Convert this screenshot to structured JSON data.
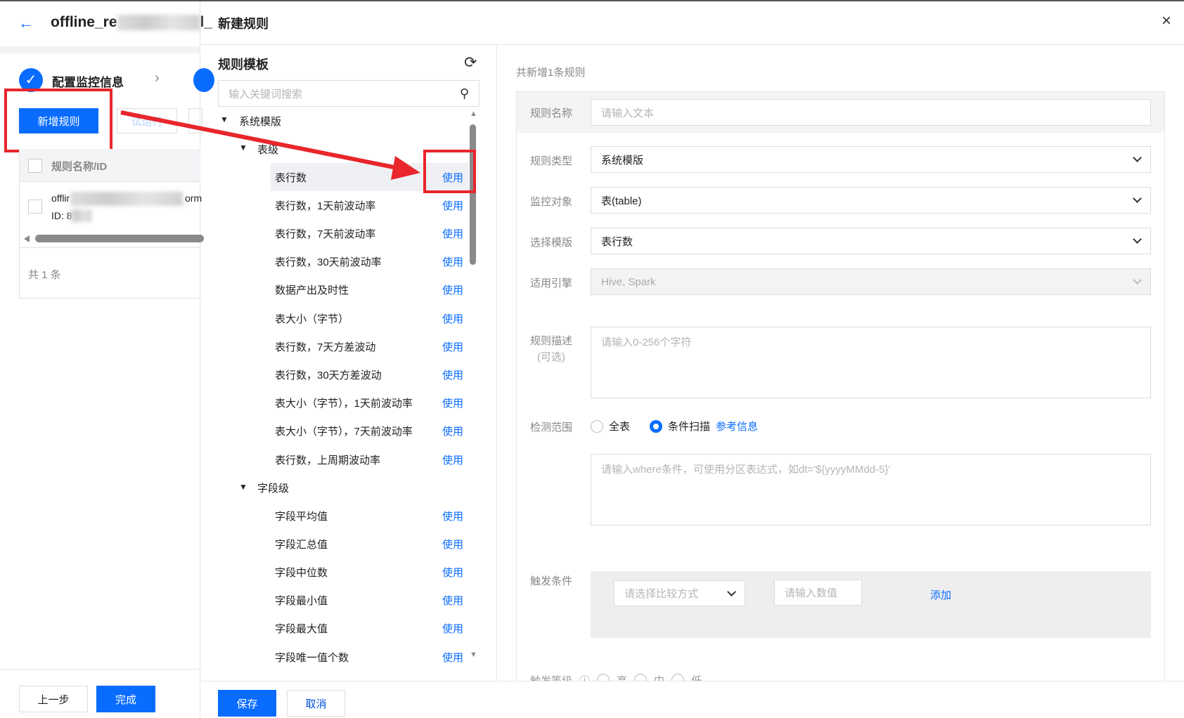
{
  "left": {
    "title_prefix": "offline_re",
    "title_suffix": "l_",
    "step1": "配置监控信息",
    "add_rule": "新增规则",
    "trial_run": "试运行",
    "col_header": "规则名称/ID",
    "row_name": "offlir",
    "row_name_tail": "orm",
    "row_id": "ID: 8",
    "total": "共 1 条",
    "prev": "上一步",
    "finish": "完成"
  },
  "dialog": {
    "title": "新建规则",
    "save": "保存",
    "cancel": "取消"
  },
  "templates": {
    "title": "规则模板",
    "search_placeholder": "输入关键词搜索",
    "group": "系统模版",
    "table_level": "表级",
    "field_level": "字段级",
    "use": "使用",
    "table_items": [
      "表行数",
      "表行数，1天前波动率",
      "表行数，7天前波动率",
      "表行数，30天前波动率",
      "数据产出及时性",
      "表大小（字节）",
      "表行数，7天方差波动",
      "表行数，30天方差波动",
      "表大小（字节），1天前波动率",
      "表大小（字节），7天前波动率",
      "表行数，上周期波动率"
    ],
    "field_items": [
      "字段平均值",
      "字段汇总值",
      "字段中位数",
      "字段最小值",
      "字段最大值",
      "字段唯一值个数"
    ]
  },
  "form": {
    "summary": "共新增1条规则",
    "name_label": "规则名称",
    "name_placeholder": "请输入文本",
    "type_label": "规则类型",
    "type_value": "系统模版",
    "object_label": "监控对象",
    "object_value": "表(table)",
    "template_label": "选择模版",
    "template_value": "表行数",
    "engine_label": "适用引擎",
    "engine_value": "Hive, Spark",
    "desc_label": "规则描述",
    "desc_optional": "(可选)",
    "desc_placeholder": "请输入0-256个字符",
    "range_label": "检测范围",
    "range_full": "全表",
    "range_cond": "条件扫描",
    "range_ref": "参考信息",
    "where_placeholder": "请输入where条件，可使用分区表达式，如dt='${yyyyMMdd-5}'",
    "trigger_label": "触发条件",
    "compare_placeholder": "请选择比较方式",
    "value_placeholder": "请输入数值",
    "add": "添加",
    "level_label": "触发等级",
    "level_high": "高",
    "level_mid": "中",
    "level_low": "低"
  },
  "colors": {
    "primary": "#0a6cff",
    "annotation": "#e8262c"
  }
}
